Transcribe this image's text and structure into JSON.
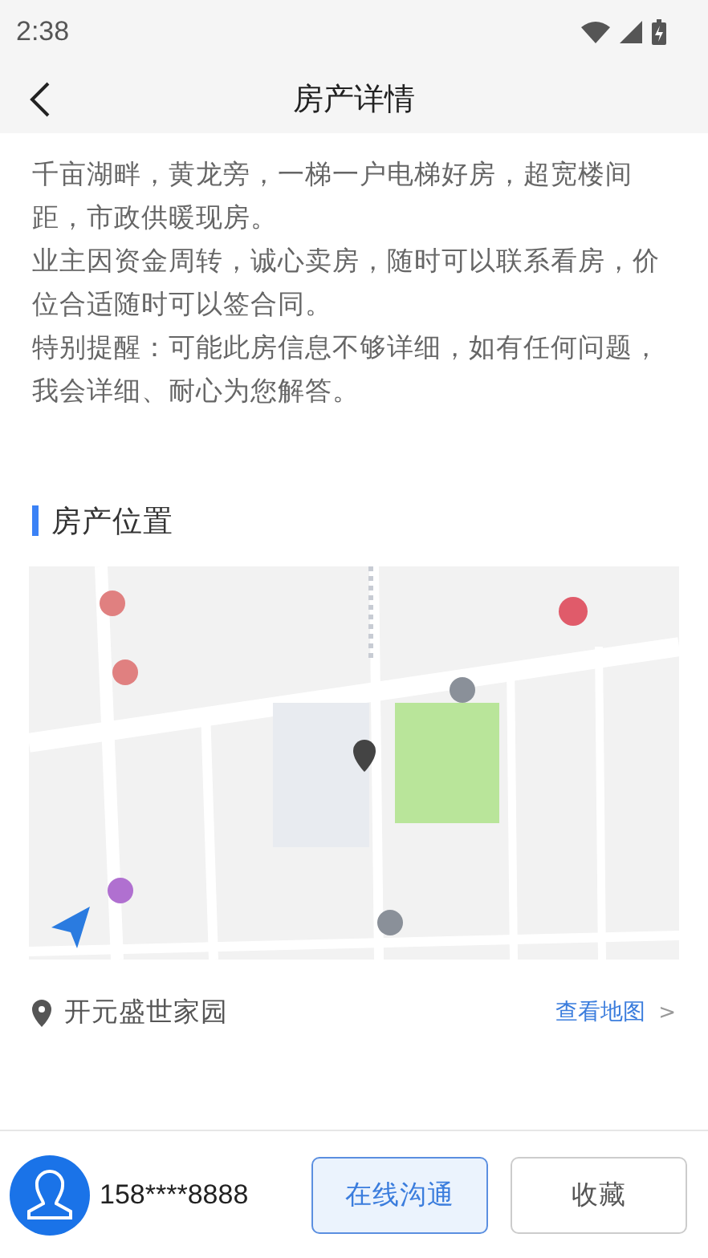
{
  "status_bar": {
    "time": "2:38"
  },
  "header": {
    "title": "房产详情"
  },
  "description": [
    "千亩湖畔，黄龙旁，一梯一户电梯好房，超宽楼间距，市政供暖现房。",
    "业主因资金周转，诚心卖房，随时可以联系看房，价位合适随时可以签合同。",
    "特别提醒：可能此房信息不够详细，如有任何问题，我会详细、耐心为您解答。"
  ],
  "location_section": {
    "title": "房产位置",
    "address": "开元盛世家园",
    "map_link": "查看地图",
    "link_arrow": ">"
  },
  "bottom_bar": {
    "phone": "158****8888",
    "buttons": [
      {
        "label": "在线沟通",
        "kind": "primary"
      },
      {
        "label": "收藏",
        "kind": "outline"
      }
    ]
  }
}
